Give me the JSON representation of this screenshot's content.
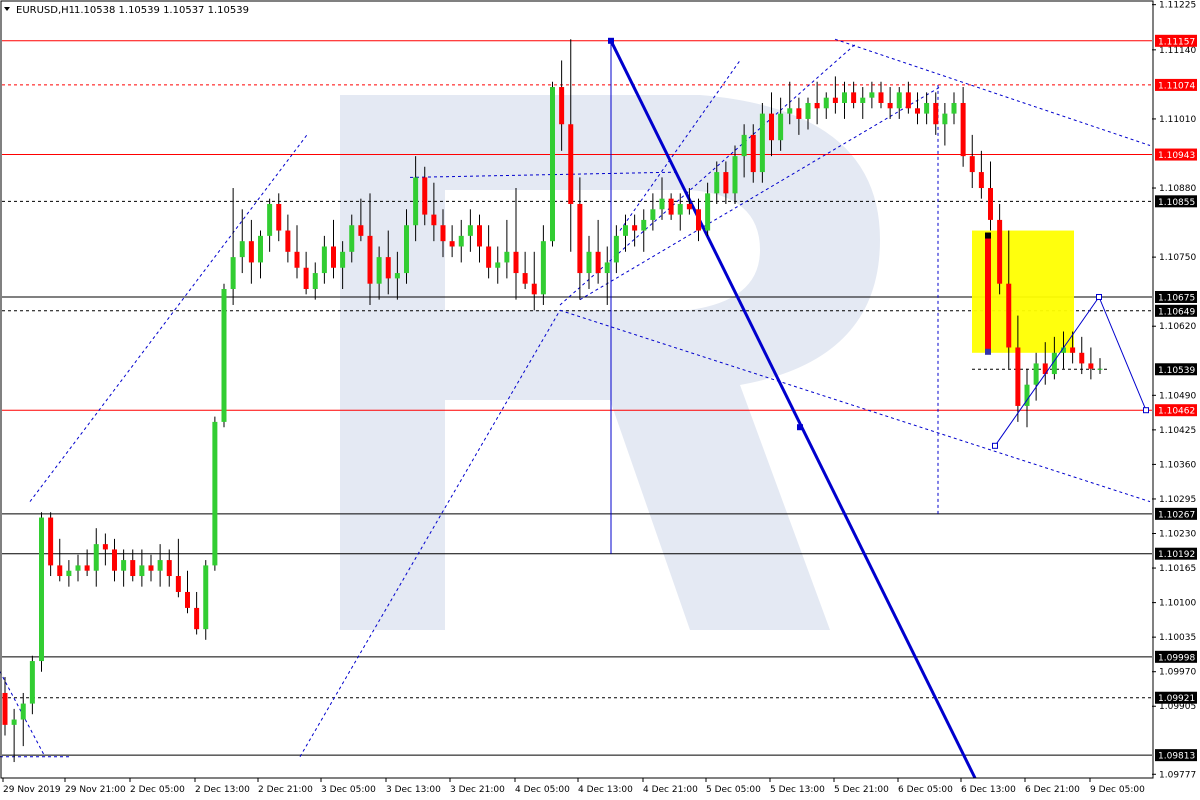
{
  "header": {
    "symbol_timeframe": "EURUSD,H1",
    "ohlc": "1.10538 1.10539 1.10537 1.10539",
    "menu_icon": "triangle-down-icon"
  },
  "colors": {
    "bull": "#32cd32",
    "bear": "#ff0000",
    "level_red": "#ff0000",
    "level_black": "#000000",
    "trend_blue": "#0000cd",
    "target_box": "#ffff00",
    "watermark": "#e4e9f3",
    "price_tag_red": "#ff0000",
    "price_tag_black": "#000000"
  },
  "chart_data": {
    "type": "candlestick",
    "instrument": "EURUSD",
    "timeframe": "H1",
    "ylim": [
      1.0977,
      1.1123
    ],
    "y_tick_labels": [
      "1.11225",
      "1.11140",
      "1.11010",
      "1.10880",
      "1.10750",
      "1.10620",
      "1.10490",
      "1.10425",
      "1.10360",
      "1.10295",
      "1.10230",
      "1.10165",
      "1.10100",
      "1.10035",
      "1.09970",
      "1.09905",
      "1.09777"
    ],
    "x_tick_labels": [
      "29 Nov 2019",
      "29 Nov 21:00",
      "2 Dec 05:00",
      "2 Dec 13:00",
      "2 Dec 21:00",
      "3 Dec 05:00",
      "3 Dec 13:00",
      "3 Dec 21:00",
      "4 Dec 05:00",
      "4 Dec 13:00",
      "4 Dec 21:00",
      "5 Dec 05:00",
      "5 Dec 13:00",
      "5 Dec 21:00",
      "6 Dec 05:00",
      "6 Dec 13:00",
      "6 Dec 21:00",
      "9 Dec 05:00"
    ],
    "price_levels": [
      {
        "label": "1.11157",
        "value": 1.11157,
        "color": "red",
        "style": "solid"
      },
      {
        "label": "1.11074",
        "value": 1.11074,
        "color": "red",
        "style": "dotted"
      },
      {
        "label": "1.10943",
        "value": 1.10943,
        "color": "red",
        "style": "solid"
      },
      {
        "label": "1.10855",
        "value": 1.10855,
        "color": "black",
        "style": "dotted"
      },
      {
        "label": "1.10675",
        "value": 1.10675,
        "color": "black",
        "style": "solid"
      },
      {
        "label": "1.10649",
        "value": 1.10649,
        "color": "black",
        "style": "dotted"
      },
      {
        "label": "1.10539",
        "value": 1.10539,
        "color": "black",
        "style": "current"
      },
      {
        "label": "1.10462",
        "value": 1.10462,
        "color": "red",
        "style": "solid"
      },
      {
        "label": "1.10267",
        "value": 1.10267,
        "color": "black",
        "style": "solid"
      },
      {
        "label": "1.10192",
        "value": 1.10192,
        "color": "black",
        "style": "solid"
      },
      {
        "label": "1.09998",
        "value": 1.09998,
        "color": "black",
        "style": "solid"
      },
      {
        "label": "1.09921",
        "value": 1.09921,
        "color": "black",
        "style": "dotted"
      },
      {
        "label": "1.09813",
        "value": 1.09813,
        "color": "black",
        "style": "solid"
      }
    ],
    "candles": [
      [
        1.0993,
        1.0996,
        1.0985,
        1.0987
      ],
      [
        1.0987,
        1.099,
        1.098,
        1.0988
      ],
      [
        1.0988,
        1.0993,
        1.0983,
        1.0991
      ],
      [
        1.0991,
        1.1,
        1.0989,
        1.0999
      ],
      [
        1.0999,
        1.1027,
        1.0997,
        1.1026
      ],
      [
        1.1026,
        1.1027,
        1.1015,
        1.1017
      ],
      [
        1.1017,
        1.1022,
        1.1014,
        1.1015
      ],
      [
        1.1015,
        1.1018,
        1.1013,
        1.1016
      ],
      [
        1.1016,
        1.1019,
        1.1014,
        1.1017
      ],
      [
        1.1017,
        1.102,
        1.1015,
        1.1016
      ],
      [
        1.1016,
        1.1024,
        1.1013,
        1.1021
      ],
      [
        1.1021,
        1.1023,
        1.1017,
        1.102
      ],
      [
        1.102,
        1.1022,
        1.1014,
        1.1016
      ],
      [
        1.1016,
        1.102,
        1.1013,
        1.1018
      ],
      [
        1.1018,
        1.102,
        1.1014,
        1.1015
      ],
      [
        1.1015,
        1.102,
        1.1013,
        1.1017
      ],
      [
        1.1017,
        1.1019,
        1.1014,
        1.1016
      ],
      [
        1.1016,
        1.1021,
        1.1013,
        1.1018
      ],
      [
        1.1018,
        1.102,
        1.1013,
        1.1015
      ],
      [
        1.1015,
        1.1022,
        1.1011,
        1.1012
      ],
      [
        1.1012,
        1.1016,
        1.1008,
        1.1009
      ],
      [
        1.1009,
        1.1012,
        1.1004,
        1.1005
      ],
      [
        1.1005,
        1.1018,
        1.1003,
        1.1017
      ],
      [
        1.1017,
        1.1045,
        1.1016,
        1.1044
      ],
      [
        1.1044,
        1.107,
        1.1043,
        1.1069
      ],
      [
        1.1069,
        1.1088,
        1.1066,
        1.1075
      ],
      [
        1.1075,
        1.1084,
        1.1072,
        1.1078
      ],
      [
        1.1078,
        1.1082,
        1.107,
        1.1074
      ],
      [
        1.1074,
        1.108,
        1.1071,
        1.1079
      ],
      [
        1.1079,
        1.1086,
        1.1076,
        1.1085
      ],
      [
        1.1085,
        1.1087,
        1.1078,
        1.108
      ],
      [
        1.108,
        1.1083,
        1.1074,
        1.1076
      ],
      [
        1.1076,
        1.1081,
        1.1071,
        1.1073
      ],
      [
        1.1073,
        1.1076,
        1.1068,
        1.1069
      ],
      [
        1.1069,
        1.1074,
        1.1067,
        1.1072
      ],
      [
        1.1072,
        1.1079,
        1.107,
        1.1077
      ],
      [
        1.1077,
        1.1082,
        1.1071,
        1.1073
      ],
      [
        1.1073,
        1.1078,
        1.1069,
        1.1076
      ],
      [
        1.1076,
        1.1083,
        1.1074,
        1.1081
      ],
      [
        1.1081,
        1.1086,
        1.1078,
        1.1079
      ],
      [
        1.1079,
        1.1087,
        1.1066,
        1.107
      ],
      [
        1.107,
        1.1077,
        1.1067,
        1.1075
      ],
      [
        1.1075,
        1.108,
        1.1068,
        1.1071
      ],
      [
        1.1071,
        1.1076,
        1.1067,
        1.1072
      ],
      [
        1.1072,
        1.1084,
        1.107,
        1.1081
      ],
      [
        1.1081,
        1.1094,
        1.1078,
        1.109
      ],
      [
        1.109,
        1.1092,
        1.1081,
        1.1083
      ],
      [
        1.1083,
        1.1089,
        1.1078,
        1.1081
      ],
      [
        1.1081,
        1.1084,
        1.1075,
        1.1078
      ],
      [
        1.1078,
        1.1081,
        1.1075,
        1.1077
      ],
      [
        1.1077,
        1.1082,
        1.1074,
        1.1079
      ],
      [
        1.1079,
        1.1084,
        1.1076,
        1.1081
      ],
      [
        1.1081,
        1.1083,
        1.1074,
        1.1077
      ],
      [
        1.1077,
        1.1081,
        1.1071,
        1.1073
      ],
      [
        1.1073,
        1.1077,
        1.107,
        1.1074
      ],
      [
        1.1074,
        1.1082,
        1.1071,
        1.1076
      ],
      [
        1.1076,
        1.1088,
        1.1067,
        1.1072
      ],
      [
        1.1072,
        1.1076,
        1.1069,
        1.107
      ],
      [
        1.107,
        1.1076,
        1.1065,
        1.1068
      ],
      [
        1.1068,
        1.1081,
        1.1066,
        1.1078
      ],
      [
        1.1078,
        1.1108,
        1.1077,
        1.1107
      ],
      [
        1.1107,
        1.1112,
        1.1095,
        1.11
      ],
      [
        1.11,
        1.1116,
        1.1076,
        1.1085
      ],
      [
        1.1085,
        1.109,
        1.1067,
        1.1072
      ],
      [
        1.1072,
        1.1079,
        1.1069,
        1.1076
      ],
      [
        1.1076,
        1.1082,
        1.107,
        1.1072
      ],
      [
        1.1072,
        1.1077,
        1.1066,
        1.1074
      ],
      [
        1.1074,
        1.1081,
        1.1072,
        1.1079
      ],
      [
        1.1079,
        1.1083,
        1.1076,
        1.1081
      ],
      [
        1.1081,
        1.1083,
        1.1077,
        1.108
      ],
      [
        1.108,
        1.1084,
        1.1076,
        1.1082
      ],
      [
        1.1082,
        1.1087,
        1.108,
        1.1084
      ],
      [
        1.1084,
        1.109,
        1.1082,
        1.1086
      ],
      [
        1.1086,
        1.1087,
        1.1082,
        1.1083
      ],
      [
        1.1083,
        1.1087,
        1.108,
        1.1085
      ],
      [
        1.1085,
        1.1088,
        1.1083,
        1.1084
      ],
      [
        1.1084,
        1.1086,
        1.1078,
        1.108
      ],
      [
        1.108,
        1.1089,
        1.1079,
        1.1087
      ],
      [
        1.1087,
        1.1093,
        1.1085,
        1.1091
      ],
      [
        1.1091,
        1.1093,
        1.1085,
        1.1087
      ],
      [
        1.1087,
        1.1096,
        1.1085,
        1.1094
      ],
      [
        1.1094,
        1.11,
        1.109,
        1.1098
      ],
      [
        1.1098,
        1.11,
        1.1089,
        1.1091
      ],
      [
        1.1091,
        1.1104,
        1.1089,
        1.1102
      ],
      [
        1.1102,
        1.1106,
        1.1094,
        1.1097
      ],
      [
        1.1097,
        1.1105,
        1.1095,
        1.1102
      ],
      [
        1.1102,
        1.1108,
        1.11,
        1.1103
      ],
      [
        1.1103,
        1.1105,
        1.1098,
        1.1101
      ],
      [
        1.1101,
        1.1105,
        1.1099,
        1.1104
      ],
      [
        1.1104,
        1.1108,
        1.11,
        1.1103
      ],
      [
        1.1103,
        1.1106,
        1.1101,
        1.1105
      ],
      [
        1.1105,
        1.1109,
        1.1102,
        1.1104
      ],
      [
        1.1104,
        1.1108,
        1.1101,
        1.1106
      ],
      [
        1.1106,
        1.1108,
        1.1103,
        1.1104
      ],
      [
        1.1104,
        1.1107,
        1.1101,
        1.1105
      ],
      [
        1.1105,
        1.1108,
        1.1103,
        1.1106
      ],
      [
        1.1106,
        1.1108,
        1.1103,
        1.1104
      ],
      [
        1.1104,
        1.1107,
        1.1101,
        1.1103
      ],
      [
        1.1103,
        1.1107,
        1.1101,
        1.1106
      ],
      [
        1.1106,
        1.1108,
        1.1102,
        1.1103
      ],
      [
        1.1103,
        1.1106,
        1.11,
        1.1102
      ],
      [
        1.1102,
        1.1106,
        1.11,
        1.1104
      ],
      [
        1.1104,
        1.1106,
        1.1098,
        1.11
      ],
      [
        1.11,
        1.1104,
        1.1096,
        1.1102
      ],
      [
        1.1102,
        1.1106,
        1.11,
        1.1104
      ],
      [
        1.1104,
        1.1107,
        1.1092,
        1.1094
      ],
      [
        1.1094,
        1.1098,
        1.1088,
        1.1091
      ],
      [
        1.1091,
        1.1095,
        1.1086,
        1.1088
      ],
      [
        1.1088,
        1.1093,
        1.108,
        1.1082
      ],
      [
        1.1082,
        1.1085,
        1.1068,
        1.107
      ],
      [
        1.107,
        1.108,
        1.1054,
        1.1058
      ],
      [
        1.1058,
        1.1064,
        1.1044,
        1.1047
      ],
      [
        1.1047,
        1.1054,
        1.1043,
        1.1051
      ],
      [
        1.1051,
        1.1057,
        1.1048,
        1.1055
      ],
      [
        1.1055,
        1.1059,
        1.1051,
        1.1053
      ],
      [
        1.1053,
        1.106,
        1.1052,
        1.1057
      ],
      [
        1.1057,
        1.1061,
        1.1054,
        1.1058
      ],
      [
        1.1058,
        1.1061,
        1.1055,
        1.1057
      ],
      [
        1.1057,
        1.106,
        1.1053,
        1.1055
      ],
      [
        1.1055,
        1.1058,
        1.1052,
        1.1054
      ],
      [
        1.1054,
        1.1056,
        1.1053,
        1.1054
      ]
    ],
    "target_zone": {
      "top": 1.108,
      "bottom": 1.1057
    },
    "forecast_path": [
      1.1057,
      1.1046,
      1.1068,
      1.1042
    ],
    "watermark": "R"
  }
}
